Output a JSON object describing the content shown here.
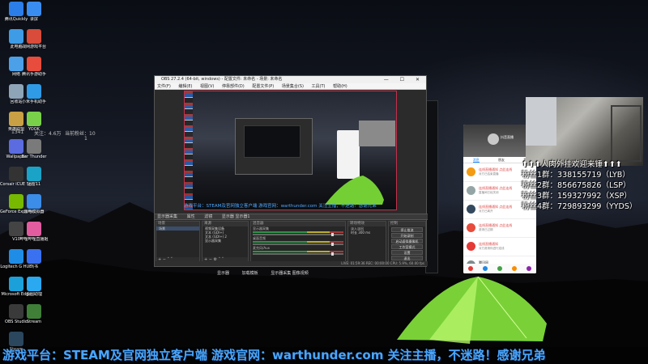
{
  "stream_stats": {
    "viewers_label": "关注：4.6万",
    "viewers_value": "",
    "fans_label": "当前粉丝：10",
    "stat2": "1341",
    "stat3": "1"
  },
  "desktop_icons": [
    {
      "label": "腾讯Quickly",
      "icon": "quickly-icon",
      "color": "#2b7de9"
    },
    {
      "label": "录屏",
      "icon": "record-icon",
      "color": "#3a8df0"
    },
    {
      "label": "此电脑",
      "icon": "pc-icon",
      "color": "#3e9be6"
    },
    {
      "label": "战网游戏平台",
      "icon": "game-icon",
      "color": "#d94b3a"
    },
    {
      "label": "网络",
      "icon": "network-icon",
      "color": "#4ca0e8"
    },
    {
      "label": "腾讯手游助手",
      "icon": "tencent-icon",
      "color": "#e74c3c"
    },
    {
      "label": "回收站",
      "icon": "recycle-bin-icon",
      "color": "#8ea5b8"
    },
    {
      "label": "小米手机助手",
      "icon": "mi-icon",
      "color": "#2f9be6"
    },
    {
      "label": "英雄联盟",
      "icon": "lol-icon",
      "color": "#c9a043"
    },
    {
      "label": "YOOK",
      "icon": "yook-icon",
      "color": "#79d14a"
    },
    {
      "label": "Wallpaper",
      "icon": "wallpaper-icon",
      "color": "#5b6be0"
    },
    {
      "label": "Bar Thunder",
      "icon": "thunder-icon",
      "color": "#7a7a7a"
    },
    {
      "label": "Corsair iCUE Software",
      "icon": "corsair-icon",
      "color": "#333333"
    },
    {
      "label": "迅雷11",
      "icon": "xunlei-icon",
      "color": "#1aa3c7"
    },
    {
      "label": "GeForce Experience",
      "icon": "geforce-icon",
      "color": "#76b900"
    },
    {
      "label": "雷电模拟器",
      "icon": "emulator-icon",
      "color": "#3b8de8"
    },
    {
      "label": "V10",
      "icon": "v10-icon",
      "color": "#444444"
    },
    {
      "label": "哔哩哔哩直播姬",
      "icon": "bilibili-icon",
      "color": "#e25ca0"
    },
    {
      "label": "Logitech G HUB",
      "icon": "logitech-icon",
      "color": "#1f8de6"
    },
    {
      "label": "飞书",
      "icon": "feishu-icon",
      "color": "#3a71f0"
    },
    {
      "label": "Microsoft Edge",
      "icon": "edge-icon",
      "color": "#1ba0d9"
    },
    {
      "label": "云图助理",
      "icon": "cloud-icon",
      "color": "#2aa8f0"
    },
    {
      "label": "OBS Studio",
      "icon": "obs-icon",
      "color": "#3a3a3a"
    },
    {
      "label": "Stream",
      "icon": "stream-icon",
      "color": "#3f7f38"
    },
    {
      "label": "Steam",
      "icon": "steam-icon",
      "color": "#2a475e"
    }
  ],
  "obs": {
    "title": "OBS 27.2.4 (64-bit, windows) - 配置文件: 未命名 - 场景: 未命名",
    "menu": [
      "文件(F)",
      "编辑(E)",
      "视图(V)",
      "停靠部件(D)",
      "配置文件(P)",
      "场景集合(S)",
      "工具(T)",
      "帮助(H)"
    ],
    "preview_ticker": "游戏平台：STEAM及官网独立客户端  游戏官网：warthunder.com  关注主播，不迷路！感谢兄弟",
    "sc_bar": [
      "显示器采集",
      "属性",
      "滤镜",
      "显示器 显示器1"
    ],
    "docks": {
      "scenes": {
        "title": "场景",
        "rows": [
          "场景"
        ],
        "foot": "+ −  ˄ ˅"
      },
      "sources": {
        "title": "来源",
        "rows": [
          "视频采集设备",
          "文本 (GDI+)",
          "文本 (GDI+) 2",
          "显示器采集"
        ],
        "foot": "+ −  ⚙ ˄ ˅"
      },
      "mixer": {
        "title": "混音器",
        "tracks": [
          "显示器采集",
          "桌面音频",
          "麦克风/Aux"
        ]
      },
      "transitions": {
        "title": "转场特效",
        "labels": [
          "淡入淡出",
          "时长 300 ms"
        ]
      },
      "controls": {
        "title": "控制",
        "buttons": [
          "停止推流",
          "开始录制",
          "启动虚拟摄像机",
          "工作室模式",
          "设置",
          "退出"
        ]
      }
    },
    "status": "LIVE: 01:59:36  REC: 00:00:00  CPU: 5.9%, 60.00 fps"
  },
  "phone": {
    "header_title": "抖音直播",
    "tabs": [
      "消息",
      "朋友",
      "我"
    ],
    "items": [
      {
        "l1": "连线直播通知 点此连线",
        "l2": "对方已结束直播",
        "color": "#e04848"
      },
      {
        "l1": "连线直播通知 点此连线",
        "l2": "直播间已经关闭",
        "color": "#e04848"
      },
      {
        "l1": "连线直播通知 点此连线",
        "l2": "对方已离开",
        "color": "#e04848"
      },
      {
        "l1": "连线直播通知 点此连线",
        "l2": "邀请已过期",
        "color": "#e04848"
      },
      {
        "l1": "连线直播通知",
        "l2": "对方邀请你进行连线",
        "color": "#e04848"
      },
      {
        "l1": "腾讯网",
        "l2": "今日热点推荐",
        "color": "#333333"
      }
    ]
  },
  "overlay": {
    "title": "⬆⬆⬆人肉外挂欢迎来锤⬆⬆⬆",
    "groups": [
      {
        "label": "粉丝1群：",
        "value": "338155719（LYB）"
      },
      {
        "label": "粉丝2群：",
        "value": "856675826（LSP）"
      },
      {
        "label": "粉丝3群：",
        "value": "159327992（XSP）"
      },
      {
        "label": "粉丝4群：",
        "value": "729893299（YYDS）"
      }
    ]
  },
  "taskbar_labels": [
    "显示器",
    "加载模板",
    "显示器采集 图像视频"
  ],
  "ticker": "游戏平台：STEAM及官网独立客户端  游戏官网：warthunder.com 关注主播，不迷路！感谢兄弟"
}
